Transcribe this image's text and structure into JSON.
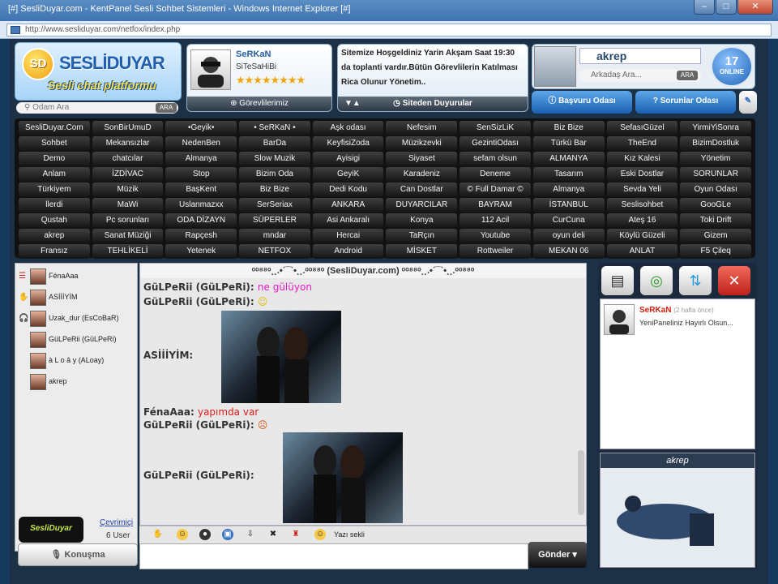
{
  "window": {
    "title": "[#] SesliDuyar.com - KentPanel Sesli Sohbet Sistemleri - Windows Internet Explorer [#]",
    "controls": [
      "–",
      "□",
      "✕"
    ]
  },
  "address": {
    "url": "http://www.sesliduyar.com/netfox/index.php"
  },
  "logo": {
    "badge": "SD",
    "title": "SESLİDUYAR",
    "subtitle": "Sesli chat platformu"
  },
  "search": {
    "placeholder": "Odam Ara",
    "button": "ARA"
  },
  "profile": {
    "name": "SeRKaN",
    "status": "SiTeSaHiBi",
    "rating_stars": 8,
    "tab": "Görevlilerimiz"
  },
  "news": {
    "text": "Sitemize Hoşgeldiniz Yarin Akşam Saat 19:30 da toplanti vardır.Bütün Görevlilerin Katılması Rica Olunur Yönetim..",
    "tab": "Siteden Duyurular"
  },
  "user": {
    "name": "akrep",
    "search_placeholder": "Arkadaş Ara...",
    "search_button": "ARA",
    "online_count": "17",
    "online_label": "ONLINE"
  },
  "buttons": {
    "basvuru": "Başvuru Odası",
    "sorunlar": "Sorunlar Odası"
  },
  "rooms": [
    "SesliDuyar.Com",
    "SonBirUmuD",
    "•Geyik•",
    "• SeRKaN •",
    "Aşk odası",
    "Nefesim",
    "SenSizLiK",
    "Biz Bize",
    "SefasıGüzel",
    "YirmiYiSonra",
    "Sohbet",
    "Mekansızlar",
    "NedenBen",
    "BarDa",
    "KeyfisiZoda",
    "Müzikzevki",
    "GezintiOdası",
    "Türkü Bar",
    "TheEnd",
    "BizimDostluk",
    "Demo",
    "chatcılar",
    "Almanya",
    "Slow Muzik",
    "Ayisigi",
    "Siyaset",
    "sefam olsun",
    "ALMANYA",
    "Kız Kalesi",
    "Yönetim",
    "Anlam",
    "İZDİVAC",
    "Stop",
    "Bizim Oda",
    "GeyiK",
    "Karadeniz",
    "Deneme",
    "Tasarım",
    "Eski Dostlar",
    "SORUNLAR",
    "Türkiyem",
    "Müzik",
    "BaşKent",
    "Biz Bize",
    "Dedi Kodu",
    "Can Dostlar",
    "© Full Damar ©",
    "Almanya",
    "Sevda Yeli",
    "Oyun Odası",
    "llerdi",
    "MaWi",
    "Uslanmazxx",
    "SerSeriax",
    "ANKARA",
    "DUYARCILAR",
    "BAYRAM",
    "İSTANBUL",
    "Seslisohbet",
    "GooGLe",
    "Qustah",
    "Pc sorunları",
    "ODA DİZAYN",
    "SÜPERLER",
    "Asi Ankaralı",
    "Konya",
    "112 Acil",
    "CurCuna",
    "Ateş 16",
    "Toki Drift",
    "akrep",
    "Sanat Müziği",
    "Rapçesh",
    "mndar",
    "Hercai",
    "TaRçın",
    "Youtube",
    "oyun deli",
    "Köylü Güzeli",
    "Gizem",
    "Fransız",
    "TEHLİKELİ",
    "Yetenek",
    "NETFOX",
    "Android",
    "MİSKET",
    "Rottweiler",
    "MEKAN 06",
    "ANLAT",
    "F5 Çileq"
  ],
  "userlist": {
    "users": [
      {
        "name": "FénaAaa",
        "icon": "list-icon"
      },
      {
        "name": "ASİİİYİM",
        "icon": "hand-icon"
      },
      {
        "name": "Uzak_dur (EsCoBaR)",
        "icon": "headphone-icon"
      },
      {
        "name": "GüLPeRii (GüLPeRi)",
        "icon": "user-icon"
      },
      {
        "name": "à L o â y (ALoay)",
        "icon": "user-icon"
      },
      {
        "name": "akrep",
        "icon": "user-icon"
      }
    ],
    "online_link": "Çevrimiçi",
    "user_count": "6 User",
    "speak_button": "Konuşma"
  },
  "chat": {
    "header": "ᵒᵒ⁸⁸ᵒ¸¸.•´¯`•¸¸.ᵒᵒ⁸⁸ᵒ (SesliDuyar.com) ᵒᵒ⁸⁸ᵒ¸¸.•´¯`•¸¸.ᵒᵒ⁸⁸ᵒ",
    "messages": [
      {
        "sender": "GüLPeRii (GüLPeRi):",
        "text": "ne gülüyon",
        "color": "#e619c6"
      },
      {
        "sender": "GüLPeRii (GüLPeRi):",
        "text": "☺",
        "color": "#e6b800"
      },
      {
        "sender": "ASİİİYİM:",
        "text": "",
        "color": "#333333"
      },
      {
        "sender": "FénaAaa:",
        "text": "yapımda var",
        "color": "#e01a1a"
      },
      {
        "sender": "GüLPeRii (GüLPeRi):",
        "text": "☹",
        "color": "#d4500e"
      },
      {
        "sender": "GüLPeRii (GüLPeRi):",
        "text": "",
        "color": "#333333"
      }
    ],
    "toolbar_label": "Yazı sekli",
    "send_button": "Gönder"
  },
  "wall": {
    "author": "SeRKaN",
    "time": "(2 hafta önce)",
    "text": "YeniPaneliniz Hayırlı Olsun..."
  },
  "cam": {
    "name": "akrep"
  }
}
